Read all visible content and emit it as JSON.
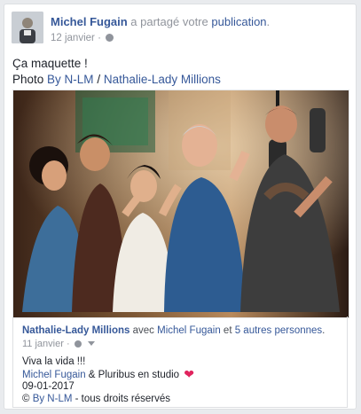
{
  "post": {
    "author": "Michel Fugain",
    "action": "a partagé votre",
    "object": "publication",
    "period": ".",
    "date": "12 janvier",
    "dot": "·",
    "text": "Ça maquette !",
    "photo_prefix": "Photo",
    "photo_credit_1": "By N-LM",
    "photo_sep": "/",
    "photo_credit_2": "Nathalie-Lady Millions"
  },
  "shared": {
    "page": "Nathalie-Lady Millions",
    "with": "avec",
    "tagged": "Michel Fugain",
    "and": "et",
    "others": "5 autres personnes",
    "period": ".",
    "date": "11 janvier",
    "dot": "·",
    "line1": "Viva la vida !!!",
    "line2_name": "Michel Fugain",
    "line2_rest": "& Pluribus en studio",
    "line3": "09-01-2017",
    "line4_copy": "©",
    "line4_link": "By N-LM",
    "line4_rest": "- tous droits réservés"
  },
  "icons": {
    "avatar": "avatar-icon",
    "globe": "globe-icon",
    "caret": "caret-down-icon",
    "heart": "heart-icon"
  },
  "colors": {
    "link": "#365899",
    "muted": "#90949c",
    "heart": "#e0245e"
  }
}
